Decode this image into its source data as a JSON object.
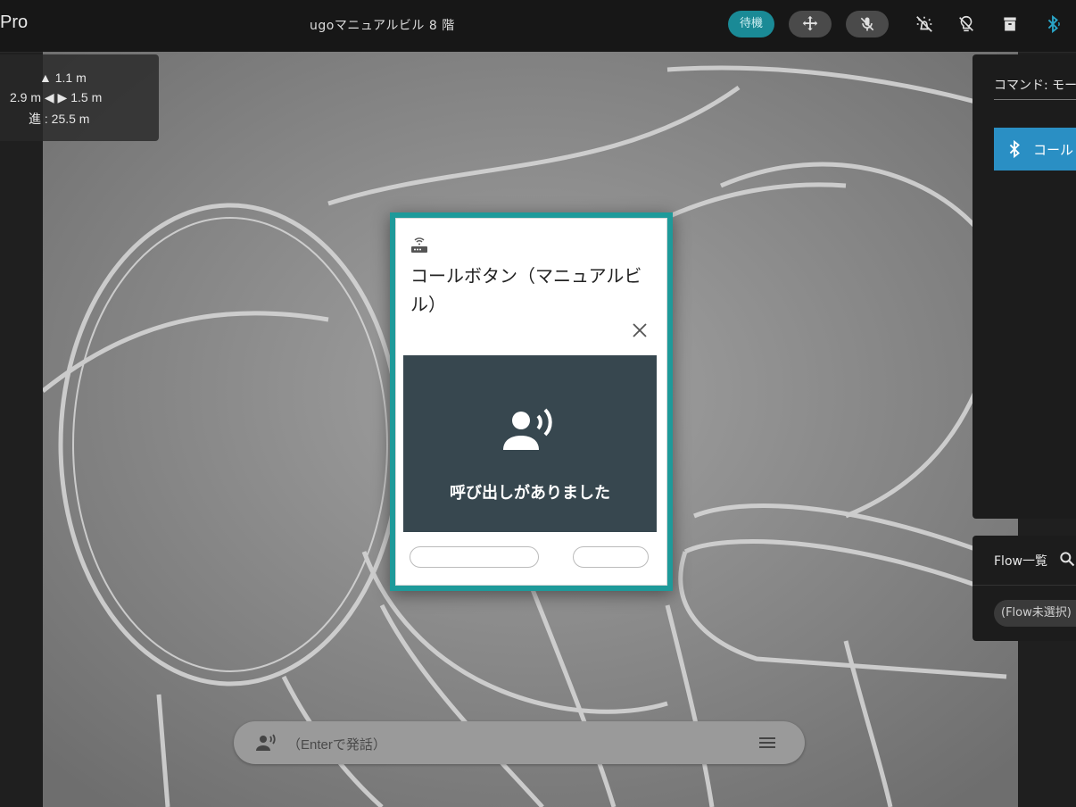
{
  "header": {
    "app_name": "Pro",
    "location": "ugoマニュアルビル 8 階",
    "status_label": "待機",
    "icons": [
      "move-icon",
      "mic-off-icon",
      "light-off-icon",
      "bulb-off-icon",
      "archive-icon",
      "bluetooth-icon"
    ]
  },
  "distance": {
    "up": "▲ 1.1 m",
    "sides": "2.9 m ◀ ▶ 1.5 m",
    "forward": "進 : 25.5 m"
  },
  "command_panel": {
    "label": "コマンド: モー",
    "button_label": "コール"
  },
  "flow_panel": {
    "title": "Flow一覧",
    "chip": "(Flow未選択)"
  },
  "speech_bar": {
    "placeholder": "（Enterで発話）"
  },
  "dialog": {
    "title": "コールボタン（マニュアルビル）",
    "message": "呼び出しがありました",
    "buttons": [
      "",
      ""
    ]
  },
  "colors": {
    "accent_teal": "#1e9a9a",
    "call_panel": "#37474f",
    "command_button": "#2a8fc4"
  }
}
